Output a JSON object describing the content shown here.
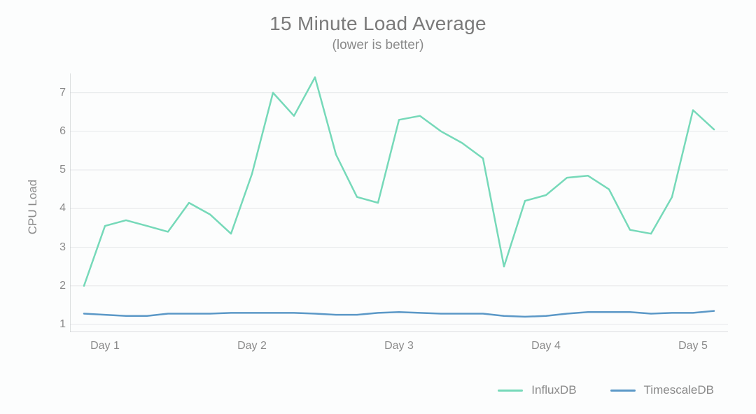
{
  "chart_data": {
    "type": "line",
    "title": "15 Minute Load Average",
    "subtitle": "(lower is better)",
    "ylabel": "CPU Load",
    "xlabel": "",
    "ylim": [
      0.8,
      7.5
    ],
    "yticks": [
      1,
      2,
      3,
      4,
      5,
      6,
      7
    ],
    "xtick_labels": [
      "Day 1",
      "Day 2",
      "Day 3",
      "Day 4",
      "Day 5"
    ],
    "xtick_positions": [
      1,
      8,
      15,
      22,
      29
    ],
    "n_points": 31,
    "series": [
      {
        "name": "InfluxDB",
        "color": "#76d9b9",
        "values": [
          2.0,
          3.55,
          3.7,
          3.55,
          3.4,
          4.15,
          3.85,
          3.35,
          4.9,
          7.0,
          6.4,
          7.4,
          5.4,
          4.3,
          4.15,
          6.3,
          6.4,
          6.0,
          5.7,
          5.3,
          2.5,
          4.2,
          4.35,
          4.8,
          4.85,
          4.5,
          3.45,
          3.35,
          4.3,
          6.55,
          6.05
        ]
      },
      {
        "name": "TimescaleDB",
        "color": "#5b98c7",
        "values": [
          1.28,
          1.25,
          1.22,
          1.22,
          1.28,
          1.28,
          1.28,
          1.3,
          1.3,
          1.3,
          1.3,
          1.28,
          1.25,
          1.25,
          1.3,
          1.32,
          1.3,
          1.28,
          1.28,
          1.28,
          1.22,
          1.2,
          1.22,
          1.28,
          1.32,
          1.32,
          1.32,
          1.28,
          1.3,
          1.3,
          1.35
        ]
      }
    ],
    "legend_position": "bottom-right"
  }
}
